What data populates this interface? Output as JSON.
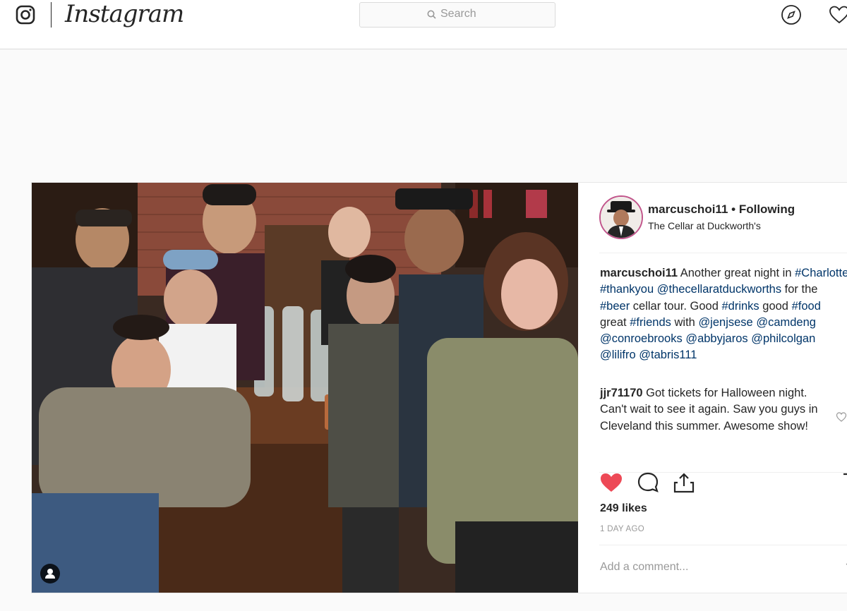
{
  "header": {
    "brand": "Instagram",
    "search_placeholder": "Search"
  },
  "post": {
    "author": {
      "username": "marcuschoi11",
      "follow_status": "Following",
      "location": "The Cellar at Duckworth's"
    },
    "caption": {
      "username": "marcuschoi11",
      "line1": "Another great night in",
      "tag_charlotte": "#Charlotte",
      "tag_thankyou": "#thankyou",
      "mention_cellar": "@thecellaratduckworths",
      "for_the": "for the",
      "tag_beer": "#beer",
      "cellar_tour": "cellar tour. Good",
      "tag_drinks": "#drinks",
      "good": "good",
      "tag_food": "#food",
      "great": "great",
      "tag_friends": "#friends",
      "with": "with",
      "mention_jenjsese": "@jenjsese",
      "mention_camdeng": "@camdeng",
      "mention_conroebrooks": "@conroebrooks",
      "mention_abbyjaros": "@abbyjaros",
      "mention_philcolgan": "@philcolgan",
      "mention_lilifro": "@lilifro",
      "mention_tabris111": "@tabris111"
    },
    "comments": [
      {
        "username": "jjr71170",
        "text": "Got tickets for Halloween night. Can't wait to see it again. Saw you guys in Cleveland this summer. Awesome show!"
      }
    ],
    "likes": "249 likes",
    "timestamp": "1 DAY AGO",
    "add_comment_placeholder": "Add a comment...",
    "colors": {
      "liked_heart": "#ed4956",
      "tag_link": "#003569",
      "muted_text": "#999999"
    }
  }
}
